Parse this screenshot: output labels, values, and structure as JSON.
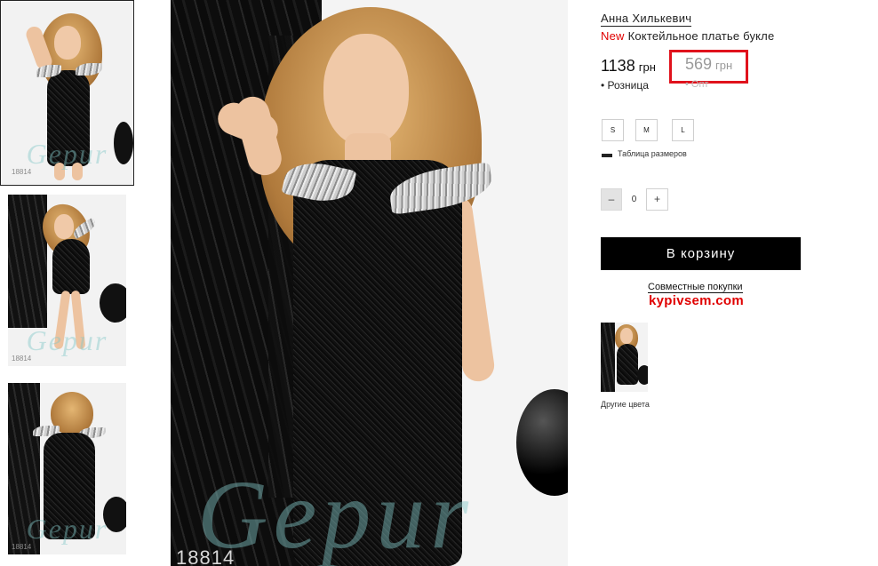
{
  "thumbnails": [
    {
      "code": "18814",
      "watermark": "Gepur"
    },
    {
      "code": "18814",
      "watermark": "Gepur"
    },
    {
      "code": "18814",
      "watermark": "Gepur"
    }
  ],
  "main_image": {
    "code": "18814",
    "watermark": "Gepur"
  },
  "product": {
    "designer": "Анна Хилькевич",
    "badge": "New",
    "title": "Коктейльное платье букле",
    "price_retail": "1138",
    "price_retail_currency": "грн",
    "price_retail_label": "• Розница",
    "price_opt": "569",
    "price_opt_currency": "грн",
    "price_opt_label": "• Опт",
    "sizes": [
      "S",
      "M",
      "L"
    ],
    "size_table_label": "Таблица размеров",
    "qty_minus": "–",
    "qty_value": "0",
    "qty_plus": "+",
    "cart_button": "В корзину",
    "joint_purchases": "Совместные покупки",
    "partner_site": "kypivsem.com",
    "other_colors": "Другие цвета"
  },
  "colors": {
    "accent_red": "#e00000",
    "highlight_box": "#e0121c",
    "button_bg": "#000000"
  }
}
